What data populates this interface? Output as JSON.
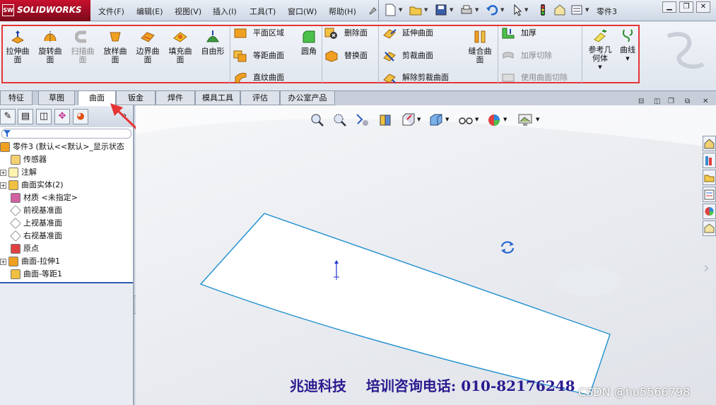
{
  "app": {
    "name": "SOLIDWORKS",
    "logo_mark": "SW",
    "doc_title": "零件3"
  },
  "menu": [
    "文件(F)",
    "编辑(E)",
    "视图(V)",
    "插入(I)",
    "工具(T)",
    "窗口(W)",
    "帮助(H)"
  ],
  "ribbon": {
    "large_commands": [
      {
        "label": "拉伸曲\n面",
        "icon": "extrude-surface-icon",
        "disabled": false
      },
      {
        "label": "旋转曲\n面",
        "icon": "revolve-surface-icon",
        "disabled": false
      },
      {
        "label": "扫描曲\n面",
        "icon": "sweep-surface-icon",
        "disabled": true
      },
      {
        "label": "放样曲\n面",
        "icon": "loft-surface-icon",
        "disabled": false
      },
      {
        "label": "边界曲\n面",
        "icon": "boundary-surface-icon",
        "disabled": false
      },
      {
        "label": "填充曲\n面",
        "icon": "fill-surface-icon",
        "disabled": false
      },
      {
        "label": "自由形",
        "icon": "freeform-icon",
        "disabled": false
      }
    ],
    "col1": [
      "平面区域",
      "等距曲面",
      "直纹曲面"
    ],
    "fillet": "圆角",
    "col2": [
      "删除面",
      "替换面"
    ],
    "col3": [
      "延伸曲面",
      "剪裁曲面",
      "解除剪裁曲面"
    ],
    "knit": "缝合曲\n面",
    "col4": [
      {
        "label": "加厚",
        "disabled": false
      },
      {
        "label": "加厚切除",
        "disabled": true
      },
      {
        "label": "使用曲面切除",
        "disabled": true
      }
    ],
    "ref_geometry": "参考几\n何体",
    "curves": "曲线"
  },
  "tabs": [
    "特征",
    "草图",
    "曲面",
    "钣金",
    "焊件",
    "模具工具",
    "评估",
    "办公室产品"
  ],
  "active_tab": "曲面",
  "feature_tree": [
    {
      "label": "零件3  (默认<<默认>_显示状态",
      "icon": "part-icon",
      "expand": "",
      "indent": 0
    },
    {
      "label": "传感器",
      "icon": "sensor-icon",
      "expand": "",
      "indent": 1
    },
    {
      "label": "注解",
      "icon": "annotation-icon",
      "expand": "+",
      "indent": 1
    },
    {
      "label": "曲面实体(2)",
      "icon": "surface-bodies-icon",
      "expand": "+",
      "indent": 1
    },
    {
      "label": "材质 <未指定>",
      "icon": "material-icon",
      "expand": "",
      "indent": 1
    },
    {
      "label": "前视基准面",
      "icon": "plane-icon",
      "expand": "",
      "indent": 1
    },
    {
      "label": "上视基准面",
      "icon": "plane-icon",
      "expand": "",
      "indent": 1
    },
    {
      "label": "右视基准面",
      "icon": "plane-icon",
      "expand": "",
      "indent": 1
    },
    {
      "label": "原点",
      "icon": "origin-icon",
      "expand": "",
      "indent": 1
    },
    {
      "label": "曲面-拉伸1",
      "icon": "extrude-surface-icon",
      "expand": "+",
      "indent": 1
    },
    {
      "label": "曲面-等距1",
      "icon": "offset-surface-icon",
      "expand": "",
      "indent": 1
    }
  ],
  "watermark": "兆迪科技    培训咨询电话: 010-82176248",
  "csdn": "CSDN @hu5566798",
  "colors": {
    "accent_red": "#e53535",
    "surface_edge": "#1e8fd0",
    "watermark": "#2a1b8f"
  }
}
